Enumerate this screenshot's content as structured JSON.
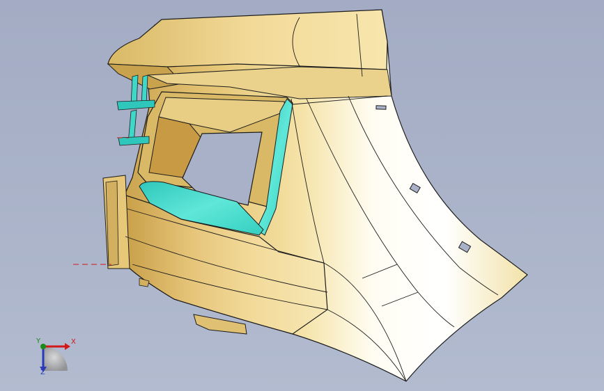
{
  "viewport": {
    "background_top": "#a3acc4",
    "background_bottom": "#b2bbcf"
  },
  "model": {
    "body_color": "#f2dc9a",
    "body_shadow_color": "#d7b865",
    "highlight_color": "#ffffff",
    "accent_color": "#3ed7c8",
    "edge_color": "#1c1c1c"
  },
  "triad": {
    "x_label": "X",
    "y_label": "Y",
    "z_label": "Z",
    "x_color": "#d21818",
    "y_color": "#1a8a1a",
    "z_color": "#2a3bb8"
  }
}
